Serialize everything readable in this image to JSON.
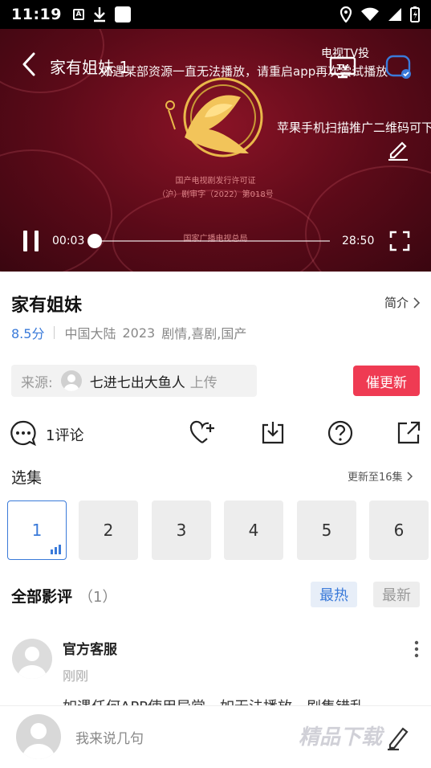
{
  "status_bar": {
    "time": "11:19",
    "icons": [
      "a-notification-icon",
      "download-icon",
      "app-square-icon",
      "location-icon",
      "wifi-icon",
      "signal-icon",
      "battery-icon"
    ]
  },
  "player": {
    "title": "家有姐妹 1",
    "marquee_notice": "如遇某部资源一直无法播放，请重启app再次尝试播放",
    "marquee_promo": "苹果手机扫描推广二维码可下",
    "tv_badge": "电视TV投",
    "license_line1": "国产电视剧发行许可证",
    "license_line2": "（沪）剧审字（2022）第018号",
    "license_line3": "国家广播电视总局",
    "current_time": "00:03",
    "total_time": "28:50",
    "progress": 0.0017
  },
  "info": {
    "title": "家有姐妹",
    "intro_label": "简介",
    "rating": "8.5分",
    "region": "中国大陆",
    "year": "2023",
    "genres": "剧情,喜剧,国产"
  },
  "source": {
    "label": "来源:",
    "name": "七进七出大鱼人",
    "suffix": "上传"
  },
  "urge_button": "催更新",
  "actions": {
    "comment_count": "1评论"
  },
  "episodes": {
    "label": "选集",
    "update_text": "更新至16集",
    "items": [
      "1",
      "2",
      "3",
      "4",
      "5",
      "6"
    ],
    "active_index": 0
  },
  "reviews": {
    "title": "全部影评",
    "count": "（1）",
    "sort_hot": "最热",
    "sort_new": "最新",
    "items": [
      {
        "user": "官方客服",
        "time": "刚刚",
        "text": "如遇任何APP使用异常，如无法播放、剧集错乱"
      }
    ]
  },
  "bottom": {
    "input_placeholder": "我来说几句",
    "watermark": "精品下载"
  },
  "colors": {
    "accent": "#3a7ad9",
    "urge": "#ef3b53",
    "player_bg": "#6a0d1e"
  }
}
